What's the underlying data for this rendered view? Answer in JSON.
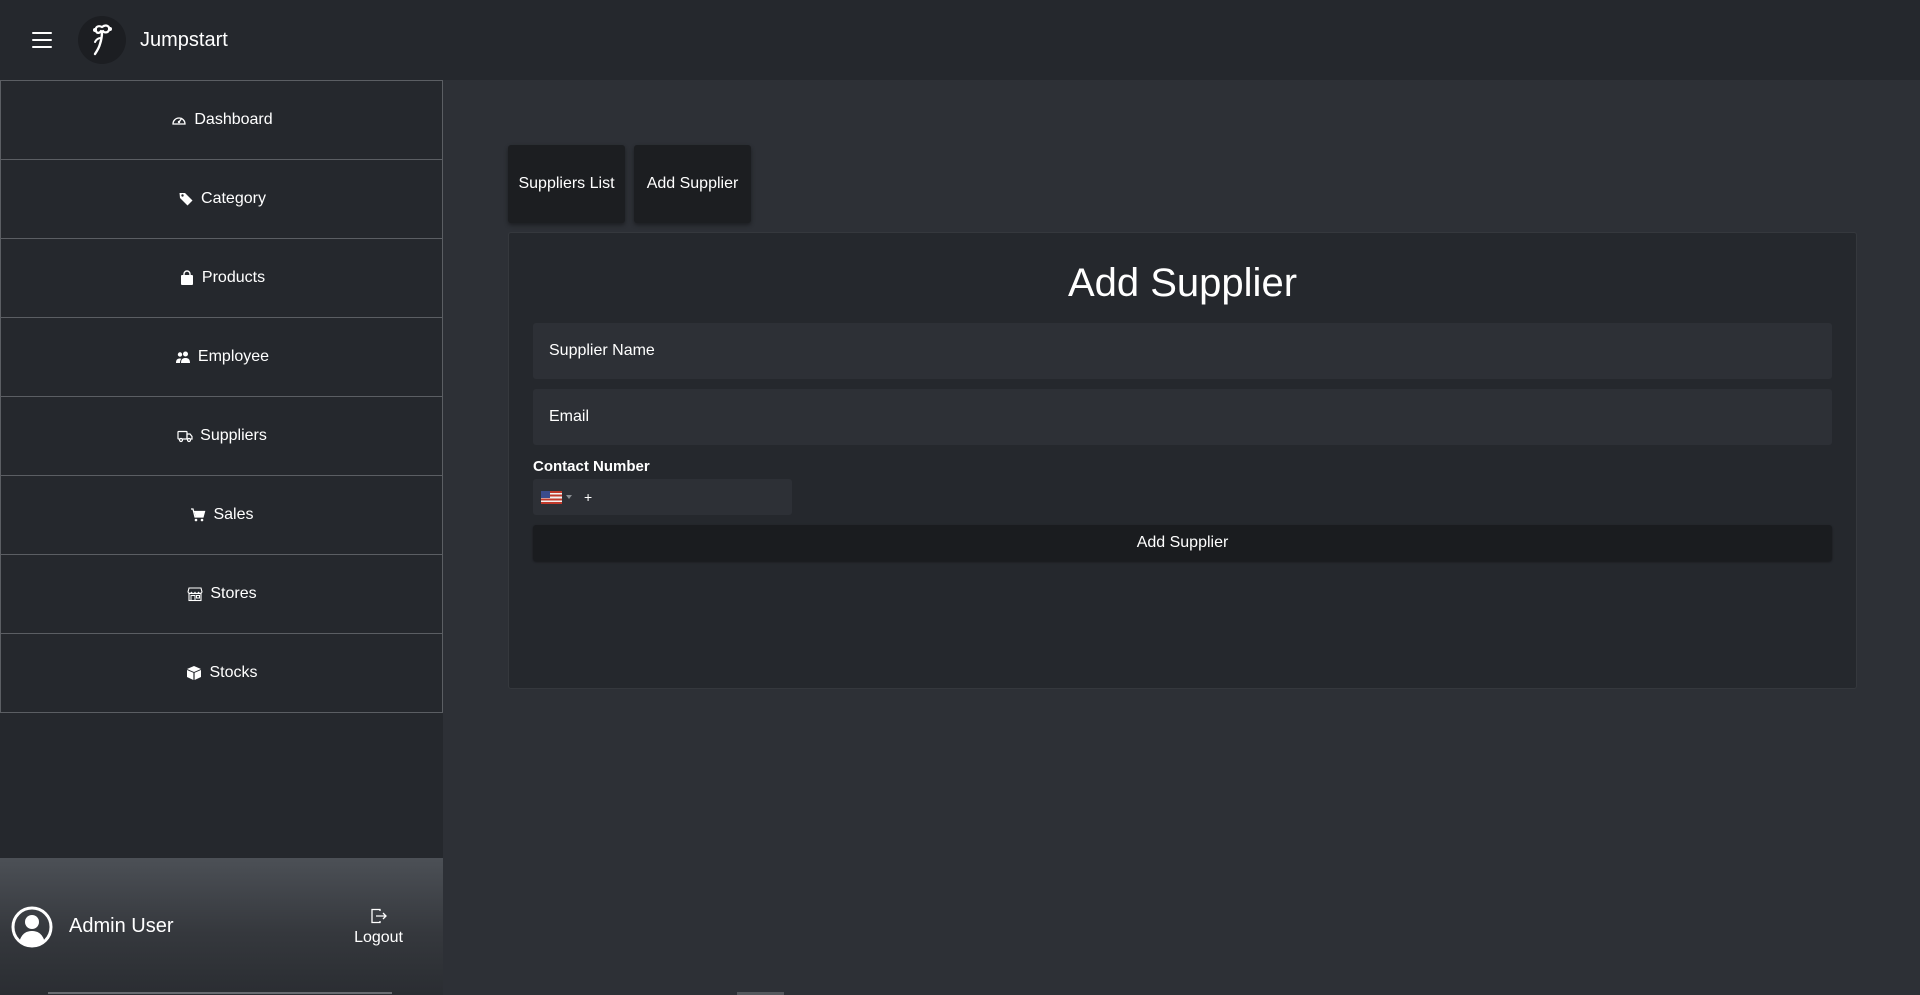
{
  "header": {
    "app_name": "Jumpstart",
    "menu_icon": "hamburger-menu-icon",
    "logo_icon": "mascot-logo-icon"
  },
  "sidebar": {
    "items": [
      {
        "label": "Dashboard",
        "icon": "speedometer-icon"
      },
      {
        "label": "Category",
        "icon": "tags-icon"
      },
      {
        "label": "Products",
        "icon": "shopping-bag-icon"
      },
      {
        "label": "Employee",
        "icon": "people-icon"
      },
      {
        "label": "Suppliers",
        "icon": "truck-icon"
      },
      {
        "label": "Sales",
        "icon": "cart-icon"
      },
      {
        "label": "Stores",
        "icon": "shop-icon"
      },
      {
        "label": "Stocks",
        "icon": "box-icon"
      }
    ],
    "user": {
      "name": "Admin User",
      "avatar_icon": "person-circle-icon",
      "logout_label": "Logout",
      "logout_icon": "logout-icon"
    }
  },
  "main": {
    "tabs": [
      {
        "label": "Suppliers List"
      },
      {
        "label": "Add Supplier"
      }
    ],
    "form": {
      "title": "Add Supplier",
      "supplier_name_placeholder": "Supplier Name",
      "email_placeholder": "Email",
      "contact_label": "Contact Number",
      "phone_country": "US",
      "phone_prefix": "+",
      "submit_label": "Add Supplier"
    }
  },
  "colors": {
    "background": "#2d3036",
    "panel": "#25282d",
    "button": "#1c1e21",
    "text": "#ffffff"
  }
}
